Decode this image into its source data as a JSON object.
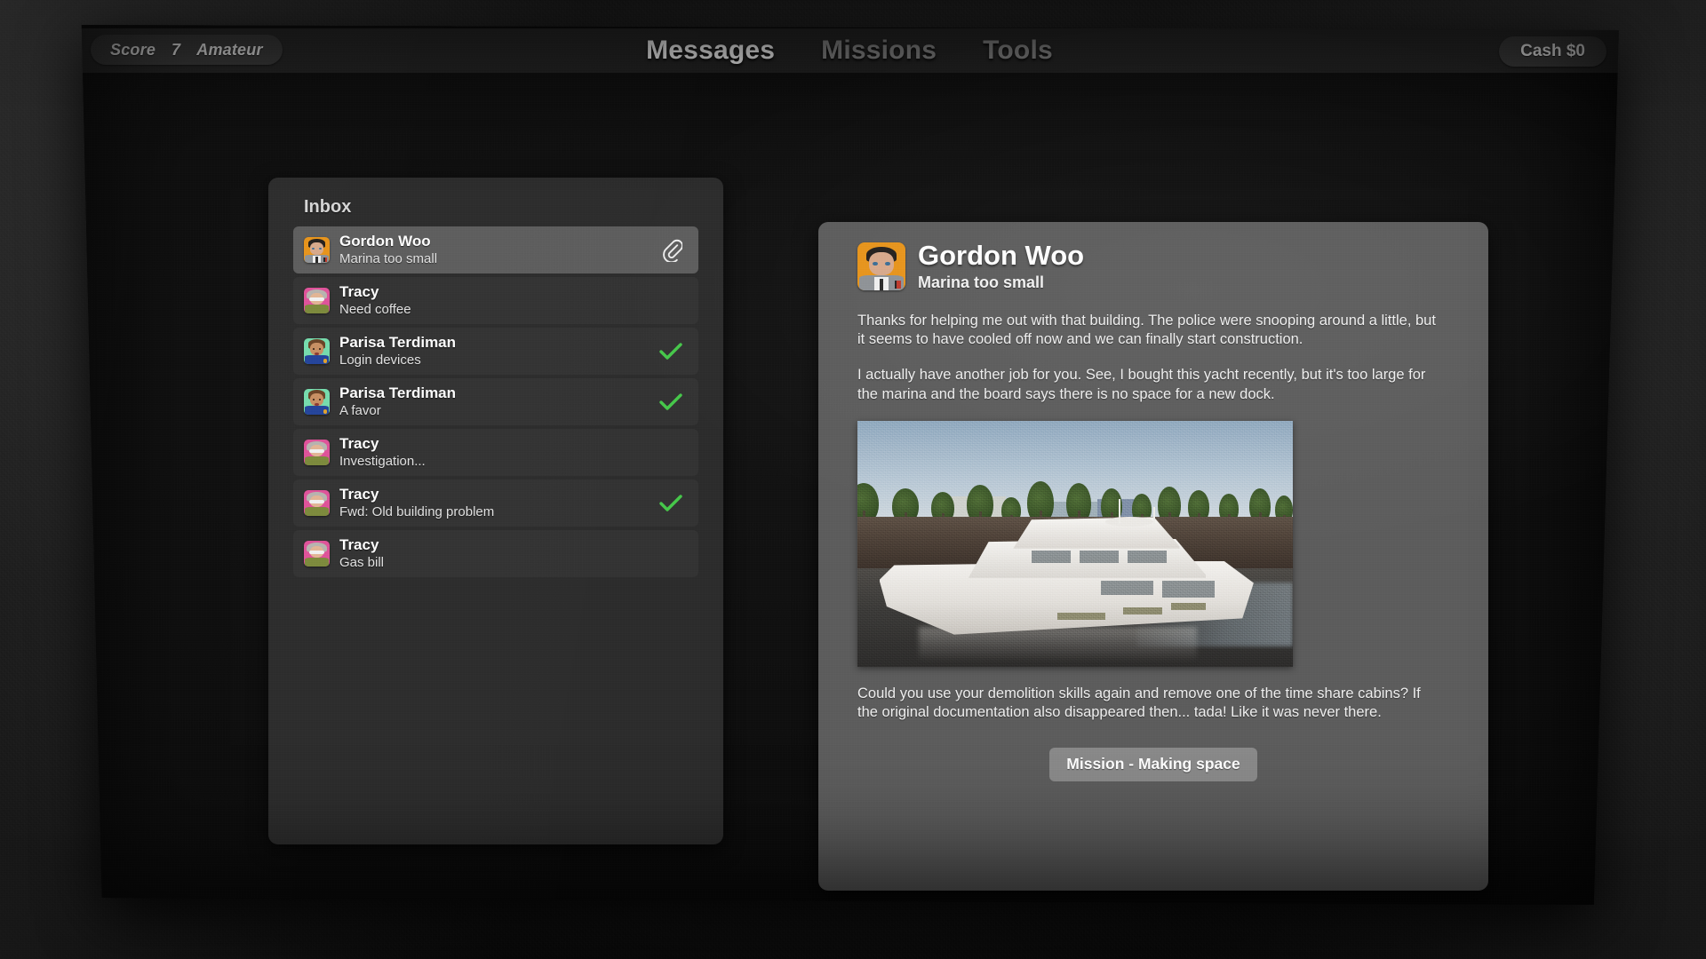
{
  "hud": {
    "score_label": "Score",
    "score_value": "7",
    "rank_label": "Amateur",
    "cash_label": "Cash $0"
  },
  "nav": {
    "items": [
      {
        "label": "Messages",
        "active": true
      },
      {
        "label": "Missions",
        "active": false
      },
      {
        "label": "Tools",
        "active": false
      }
    ]
  },
  "inbox": {
    "title": "Inbox",
    "items": [
      {
        "sender": "Gordon Woo",
        "subject": "Marina too small",
        "avatar": "gordon",
        "selected": true,
        "flag": "attachment"
      },
      {
        "sender": "Tracy",
        "subject": "Need coffee",
        "avatar": "tracy",
        "selected": false,
        "flag": "none"
      },
      {
        "sender": "Parisa Terdiman",
        "subject": "Login devices",
        "avatar": "parisa",
        "selected": false,
        "flag": "check"
      },
      {
        "sender": "Parisa Terdiman",
        "subject": "A favor",
        "avatar": "parisa",
        "selected": false,
        "flag": "check"
      },
      {
        "sender": "Tracy",
        "subject": "Investigation...",
        "avatar": "tracy",
        "selected": false,
        "flag": "none"
      },
      {
        "sender": "Tracy",
        "subject": "Fwd: Old building problem",
        "avatar": "tracy",
        "selected": false,
        "flag": "check"
      },
      {
        "sender": "Tracy",
        "subject": "Gas bill",
        "avatar": "tracy",
        "selected": false,
        "flag": "none"
      }
    ]
  },
  "message": {
    "sender": "Gordon Woo",
    "subject": "Marina too small",
    "avatar": "gordon",
    "paragraph1": "Thanks for helping me out with that building. The police were snooping around a little, but it seems to have cooled off now and we can finally start construction.",
    "paragraph2": "I actually have another job for you. See, I bought this yacht recently, but it's too large for the marina and the board says there is no space for a new dock.",
    "paragraph3": "Could you use your demolition skills again and remove one of the time share cabins? If the original documentation also disappeared then... tada! Like it was never there.",
    "image_alt": "white yacht moored beside a stone marina wall with trees behind",
    "mission_button": "Mission - Making space"
  },
  "colors": {
    "accent_check": "#46c94a",
    "panel_inbox": "#2c2c2c",
    "panel_message": "#5d5d5d",
    "row": "#333333",
    "row_selected": "#5e5e5e",
    "nav_active": "#ffffff",
    "nav_inactive": "#8e8e8e",
    "avatar_gordon_bg": "#e8941b",
    "avatar_tracy_bg": "#e0529a",
    "avatar_parisa_bg": "#76ddae"
  }
}
